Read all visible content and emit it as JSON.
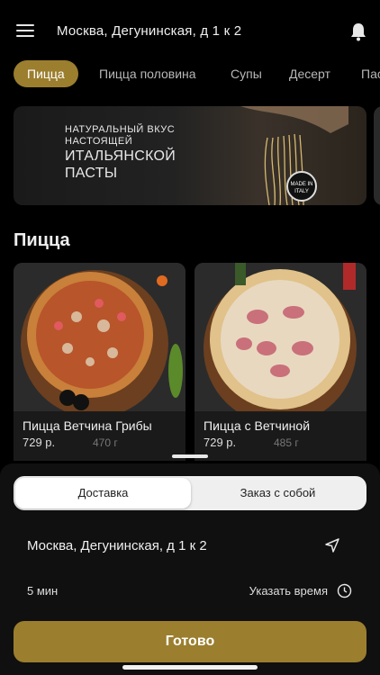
{
  "header": {
    "address": "Москва, Дегунинская, д 1 к 2"
  },
  "tabs": [
    {
      "label": "Пицца",
      "active": true
    },
    {
      "label": "Пицца половина"
    },
    {
      "label": "Супы"
    },
    {
      "label": "Десерт"
    },
    {
      "label": "Пас"
    }
  ],
  "banner": {
    "line1": "Натуральный вкус",
    "line2": "настоящей",
    "line3": "итальянской",
    "line4": "пасты",
    "badge": "MADE IN ITALY"
  },
  "section": {
    "title": "Пицца"
  },
  "products": [
    {
      "name": "Пицца Ветчина Грибы",
      "price": "729 р.",
      "weight": "470 г"
    },
    {
      "name": "Пицца с Ветчиной",
      "price": "729 р.",
      "weight": "485 г"
    }
  ],
  "delivery": {
    "tab_delivery": "Доставка",
    "tab_pickup": "Заказ с собой",
    "address": "Москва, Дегунинская, д 1 к 2",
    "eta": "5 мин",
    "set_time": "Указать время",
    "submit": "Готово"
  },
  "colors": {
    "accent": "#9b7e2e",
    "background": "#000000",
    "sheet": "#101010"
  }
}
